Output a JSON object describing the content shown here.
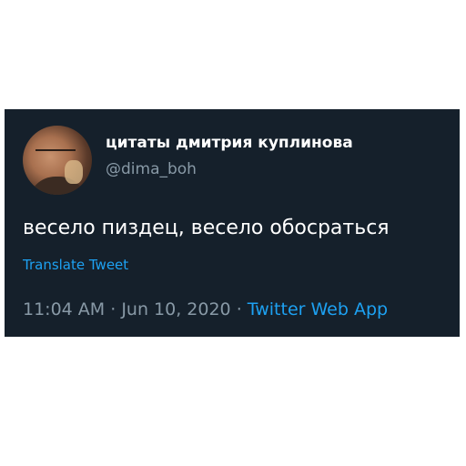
{
  "tweet": {
    "display_name": "цитаты дмитрия куплинова",
    "handle": "@dima_boh",
    "text": "весело пиздец, весело обосраться",
    "translate_label": "Translate Tweet",
    "time": "11:04 AM",
    "separator": " · ",
    "date": "Jun 10, 2020",
    "source": "Twitter Web App",
    "avatar_icon": "profile-photo"
  },
  "colors": {
    "background": "#15202b",
    "name": "#ffffff",
    "secondary_text": "#8899a6",
    "link": "#1da1f2"
  }
}
